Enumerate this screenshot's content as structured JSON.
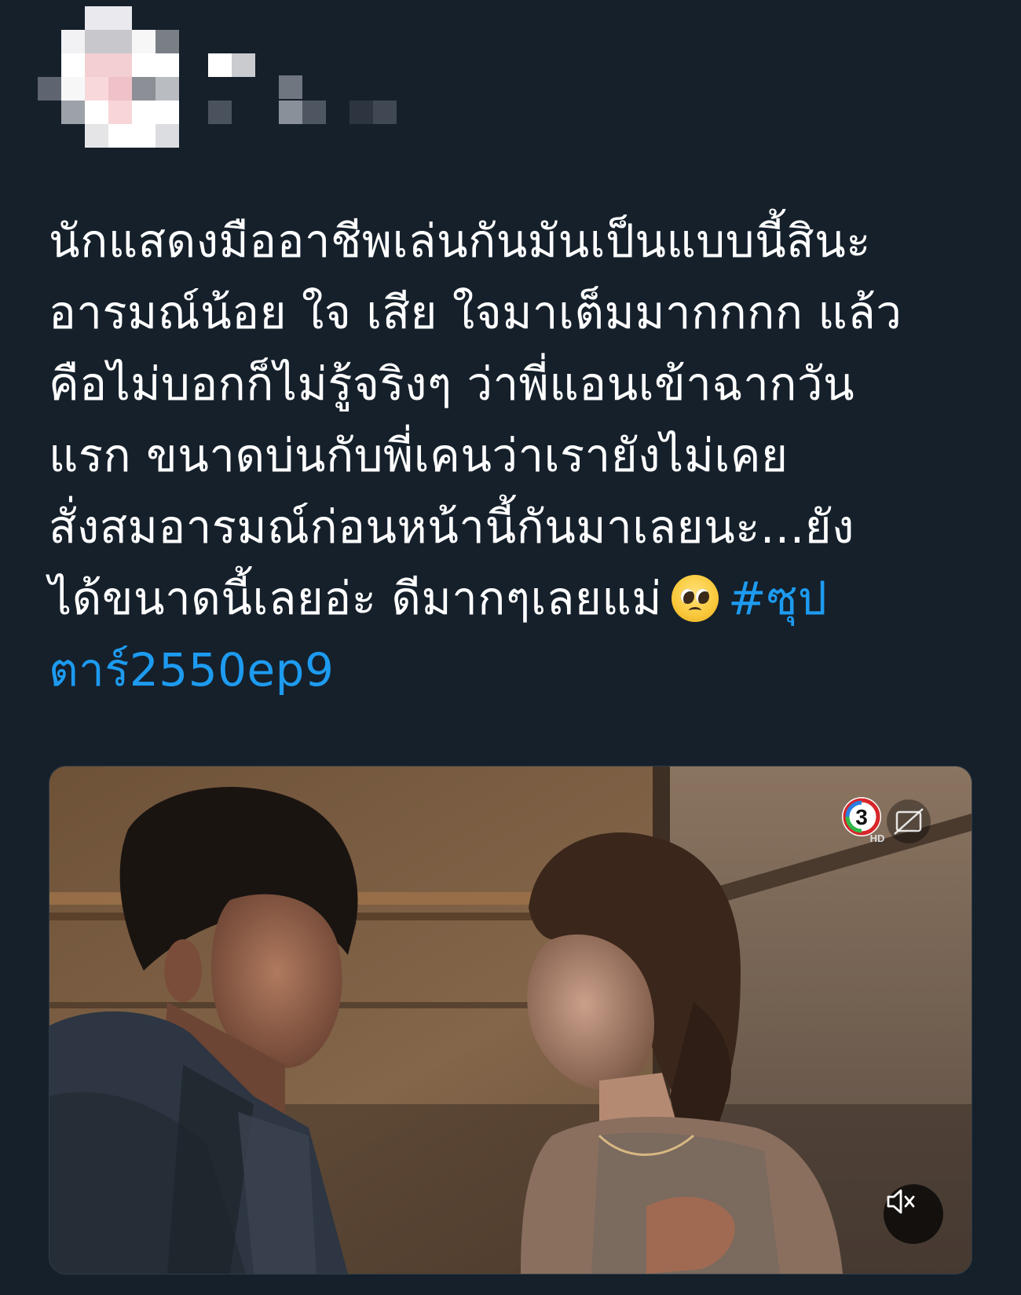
{
  "tweet": {
    "lines": [
      "นักแสดงมืออาชีพเล่นกันมันเป็นแบบนี้สินะ",
      "อารมณ์น้อย ใจ เสีย ใจมาเต็มมากกกก แล้ว",
      "คือไม่บอกก็ไม่รู้จริงๆ ว่าพี่แอนเข้าฉากวัน",
      "แรก ขนาดบ่นกับพี่เคนว่าเรายังไม่เคย",
      "สั่งสมอารมณ์ก่อนหน้านี้กันมาเลยนะ...ยัง",
      "ได้ขนาดนี้เลยอ่ะ ดีมากๆเลยแม่"
    ],
    "hashtag_part1": "#ซุป",
    "hashtag_part2": "ตาร์2550ep9",
    "emoji": "pleading-face"
  },
  "media": {
    "type": "video",
    "channel_logo": "ch3-hd-logo",
    "channel_logo_text": "3",
    "channel_logo_sub": "HD",
    "captions_icon": "closed-captions-icon",
    "mute_icon": "speaker-muted-icon"
  },
  "colors": {
    "background": "#15202b",
    "text": "#ffffff",
    "link": "#1d9bf0"
  }
}
